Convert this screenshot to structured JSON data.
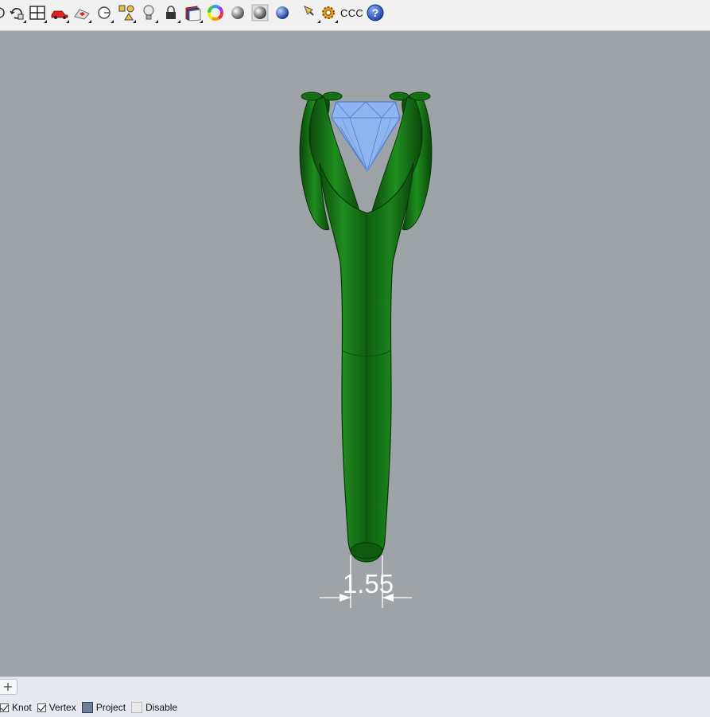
{
  "toolbar": {
    "items": [
      {
        "name": "rotate-view-icon"
      },
      {
        "name": "four-viewports-icon"
      },
      {
        "name": "car-icon"
      },
      {
        "name": "car-tilted-icon"
      },
      {
        "name": "set-view-icon"
      },
      {
        "name": "objects-icon"
      },
      {
        "name": "light-bulb-icon"
      },
      {
        "name": "lock-icon"
      },
      {
        "name": "layers-book-icon"
      },
      {
        "name": "color-wheel-icon"
      },
      {
        "name": "shaded-sphere-icon"
      },
      {
        "name": "rendered-sphere-icon"
      },
      {
        "name": "blue-sphere-icon"
      },
      {
        "name": "flashlight-icon"
      },
      {
        "name": "gear-icon"
      },
      {
        "name": "help-icon"
      }
    ],
    "ccc_label": "CCC"
  },
  "viewport": {
    "dimension_label": "1.55",
    "colors": {
      "background": "#9ea3a8",
      "ring": "#1d7a1d",
      "gem": "#8fb4f0",
      "dimension": "#ffffff"
    }
  },
  "statusbar": {
    "snaps": [
      {
        "label": "Knot",
        "state": "checked"
      },
      {
        "label": "Vertex",
        "state": "checked"
      },
      {
        "label": "Project",
        "state": "filled"
      },
      {
        "label": "Disable",
        "state": "empty"
      }
    ]
  }
}
